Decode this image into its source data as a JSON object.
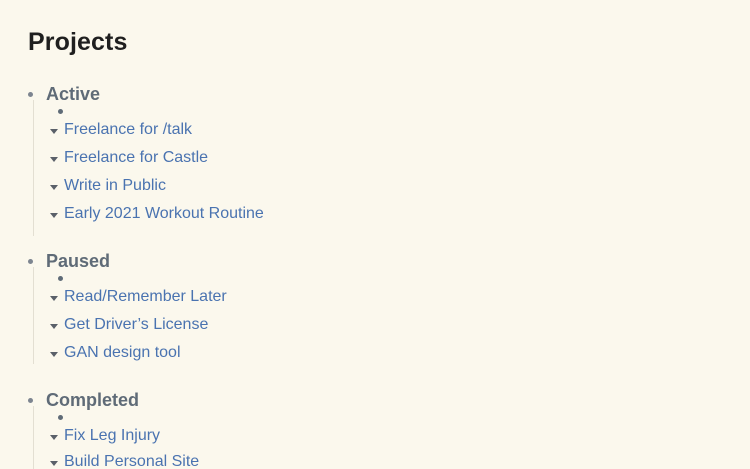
{
  "page": {
    "title": "Projects"
  },
  "sections": [
    {
      "label": "Active",
      "items": [
        {
          "label": "Freelance for /talk"
        },
        {
          "label": "Freelance for Castle"
        },
        {
          "label": "Write in Public"
        },
        {
          "label": "Early 2021 Workout Routine"
        }
      ]
    },
    {
      "label": "Paused",
      "items": [
        {
          "label": "Read/Remember Later"
        },
        {
          "label": "Get Driver’s License"
        },
        {
          "label": "GAN design tool"
        }
      ]
    },
    {
      "label": "Completed",
      "items": [
        {
          "label": "Fix Leg Injury"
        },
        {
          "label": "Build Personal Site"
        }
      ]
    }
  ],
  "colors": {
    "background": "#fbf8ed",
    "title": "#1f1f1f",
    "section_label": "#5f6b77",
    "link": "#4a73b0"
  },
  "icons": {
    "collapse_caret": "caret-down-icon",
    "bullet": "bullet-dot-icon"
  }
}
